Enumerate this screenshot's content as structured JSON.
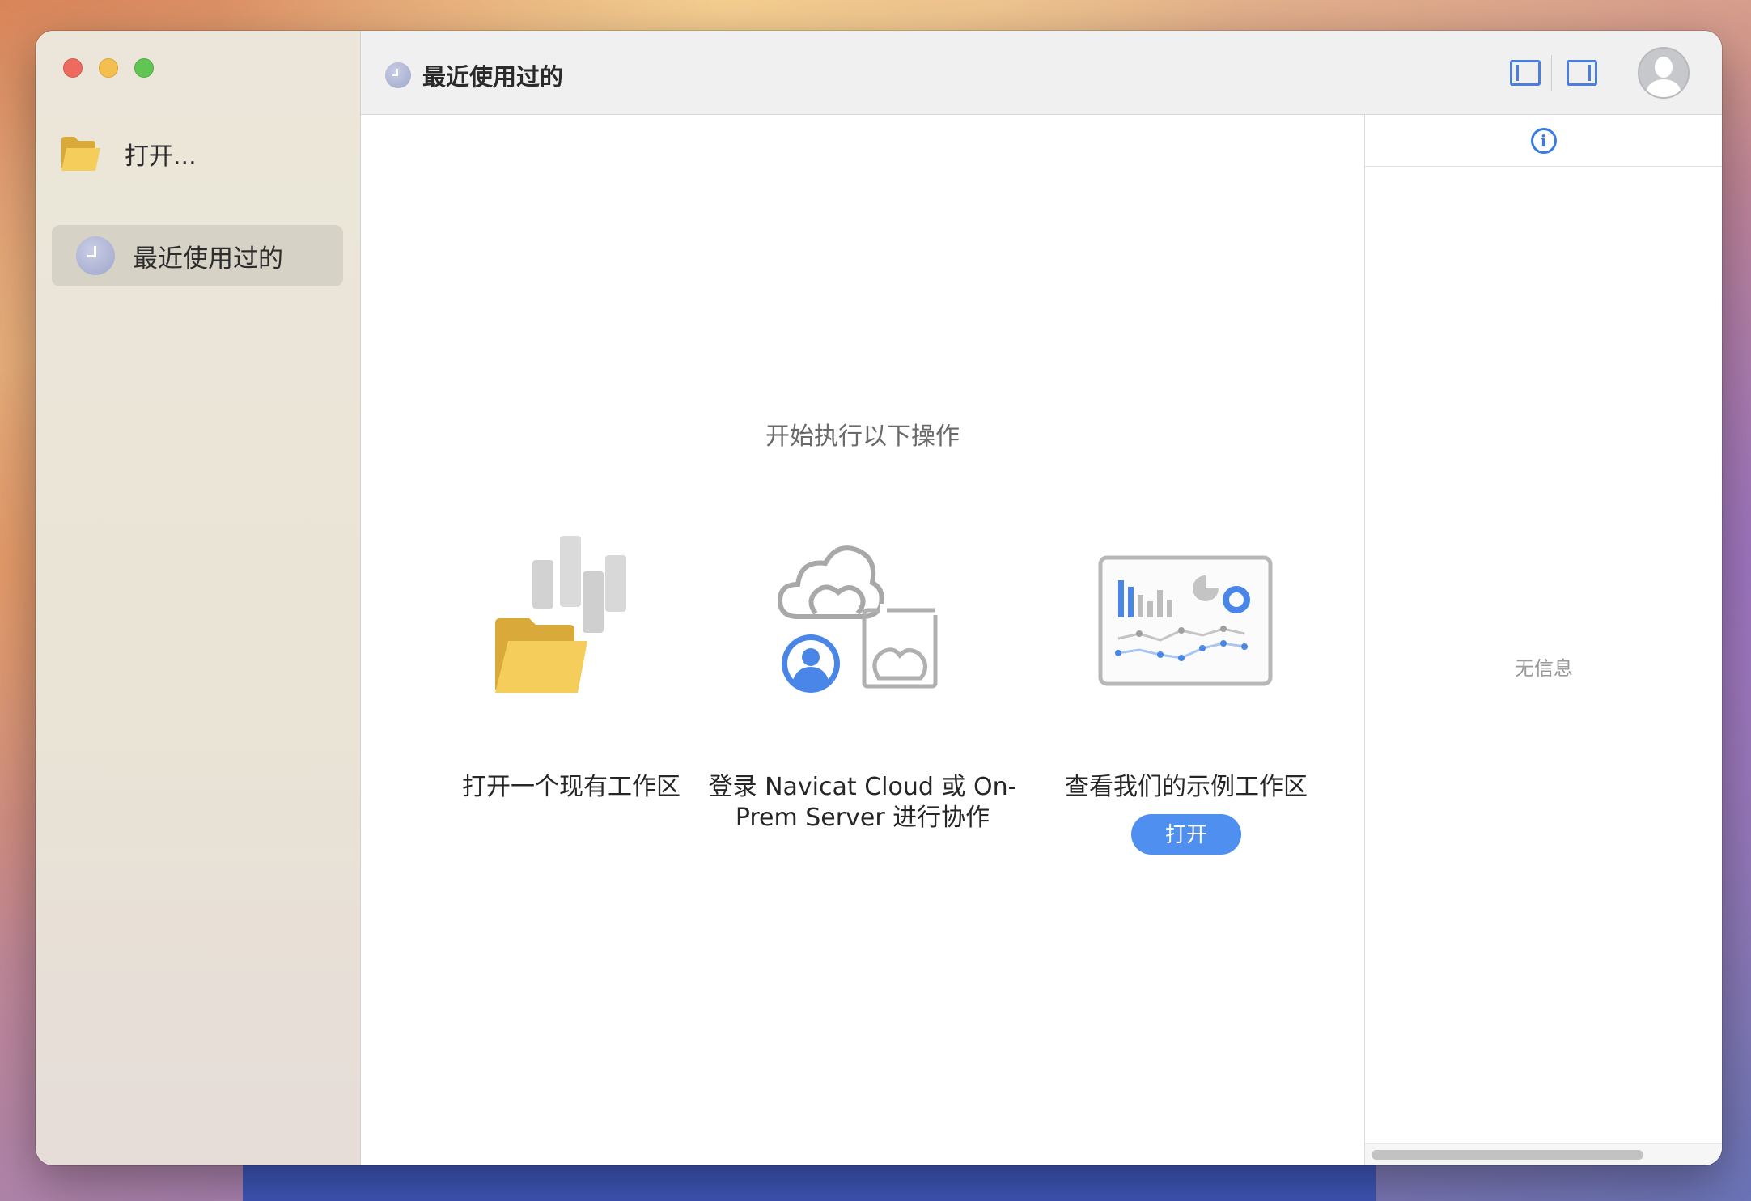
{
  "sidebar": {
    "open_label": "打开...",
    "recent_label": "最近使用过的"
  },
  "toolbar": {
    "title": "最近使用过的"
  },
  "main": {
    "heading": "开始执行以下操作",
    "cards": [
      {
        "label": "打开一个现有工作区"
      },
      {
        "label_line1": "登录 Navicat Cloud 或 On-",
        "label_line2": "Prem Server 进行协作"
      },
      {
        "label": "查看我们的示例工作区",
        "button_label": "打开"
      }
    ]
  },
  "inspector": {
    "empty_text": "无信息",
    "info_glyph": "i"
  },
  "colors": {
    "accent": "#4f8ff0",
    "folder": "#f2c94c",
    "sidebar_bg": "#ebe6d9"
  }
}
